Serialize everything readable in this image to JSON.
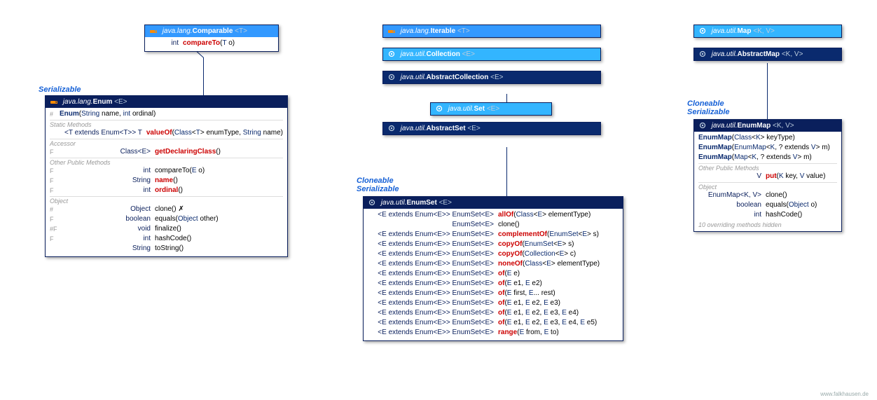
{
  "footer": "www.falkhausen.de",
  "tags": {
    "serializable": "Serializable",
    "cloneable_ser": "Cloneable\nSerializable",
    "cloneable_ser2": "Cloneable\nSerializable"
  },
  "comparable": {
    "pkg": "java.lang.",
    "name": "Comparable",
    "gen": "<T>",
    "rows": [
      {
        "mod": "",
        "ret": "int",
        "nm": "compareTo",
        "nmc": "red",
        "sig": "(T o)"
      }
    ]
  },
  "enum": {
    "pkg": "java.lang.",
    "name": "Enum",
    "gen": "<E>",
    "ctor": {
      "mod": "#",
      "name": "Enum",
      "sig": "(String name, int ordinal)"
    },
    "static_lbl": "Static Methods",
    "static": [
      {
        "mod": "",
        "ret": "<T extends Enum<T>> T",
        "nm": "valueOf",
        "nmc": "red",
        "sig": "(Class<T> enumType, String name)"
      }
    ],
    "accessor_lbl": "Accessor",
    "accessor": [
      {
        "mod": "F",
        "ret": "Class<E>",
        "nm": "getDeclaringClass",
        "nmc": "red",
        "sig": "()"
      }
    ],
    "other_lbl": "Other Public Methods",
    "other": [
      {
        "mod": "F",
        "ret": "int",
        "nm": "compareTo",
        "nmc": "",
        "sig": "(E o)"
      },
      {
        "mod": "F",
        "ret": "String",
        "nm": "name",
        "nmc": "red",
        "sig": "()"
      },
      {
        "mod": "F",
        "ret": "int",
        "nm": "ordinal",
        "nmc": "red",
        "sig": "()"
      }
    ],
    "object_lbl": "Object",
    "object": [
      {
        "mod": "#",
        "ret": "Object",
        "nm": "clone",
        "nmc": "",
        "sig": "() ✗",
        "note": ""
      },
      {
        "mod": "F",
        "ret": "boolean",
        "nm": "equals",
        "nmc": "",
        "sig": "(Object other)"
      },
      {
        "mod": "#F",
        "ret": "void",
        "nm": "finalize",
        "nmc": "",
        "sig": "()"
      },
      {
        "mod": "F",
        "ret": "int",
        "nm": "hashCode",
        "nmc": "",
        "sig": "()"
      },
      {
        "mod": "",
        "ret": "String",
        "nm": "toString",
        "nmc": "",
        "sig": "()"
      }
    ]
  },
  "stack": {
    "iterable": {
      "pkg": "java.lang.",
      "name": "Iterable",
      "gen": "<T>"
    },
    "collection": {
      "pkg": "java.util.",
      "name": "Collection",
      "gen": "<E>"
    },
    "abscoll": {
      "pkg": "java.util.",
      "name": "AbstractCollection",
      "gen": "<E>"
    },
    "set": {
      "pkg": "java.util.",
      "name": "Set",
      "gen": "<E>"
    },
    "absset": {
      "pkg": "java.util.",
      "name": "AbstractSet",
      "gen": "<E>"
    }
  },
  "enumset": {
    "pkg": "java.util.",
    "name": "EnumSet",
    "gen": "<E>",
    "rows": [
      {
        "pre": "<E extends Enum<E>>",
        "ret": "EnumSet<E>",
        "nm": "allOf",
        "nmc": "red",
        "sig": "(Class<E> elementType)"
      },
      {
        "pre": "",
        "ret": "EnumSet<E>",
        "nm": "clone",
        "nmc": "",
        "sig": "()"
      },
      {
        "pre": "<E extends Enum<E>>",
        "ret": "EnumSet<E>",
        "nm": "complementOf",
        "nmc": "red",
        "sig": "(EnumSet<E> s)"
      },
      {
        "pre": "<E extends Enum<E>>",
        "ret": "EnumSet<E>",
        "nm": "copyOf",
        "nmc": "red",
        "sig": "(EnumSet<E> s)"
      },
      {
        "pre": "<E extends Enum<E>>",
        "ret": "EnumSet<E>",
        "nm": "copyOf",
        "nmc": "red",
        "sig": "(Collection<E> c)"
      },
      {
        "pre": "<E extends Enum<E>>",
        "ret": "EnumSet<E>",
        "nm": "noneOf",
        "nmc": "red",
        "sig": "(Class<E> elementType)"
      },
      {
        "pre": "<E extends Enum<E>>",
        "ret": "EnumSet<E>",
        "nm": "of",
        "nmc": "red",
        "sig": "(E e)"
      },
      {
        "pre": "<E extends Enum<E>>",
        "ret": "EnumSet<E>",
        "nm": "of",
        "nmc": "red",
        "sig": "(E e1, E e2)"
      },
      {
        "pre": "<E extends Enum<E>>",
        "ret": "EnumSet<E>",
        "nm": "of",
        "nmc": "red",
        "sig": "(E first, E... rest)"
      },
      {
        "pre": "<E extends Enum<E>>",
        "ret": "EnumSet<E>",
        "nm": "of",
        "nmc": "red",
        "sig": "(E e1, E e2, E e3)"
      },
      {
        "pre": "<E extends Enum<E>>",
        "ret": "EnumSet<E>",
        "nm": "of",
        "nmc": "red",
        "sig": "(E e1, E e2, E e3, E e4)"
      },
      {
        "pre": "<E extends Enum<E>>",
        "ret": "EnumSet<E>",
        "nm": "of",
        "nmc": "red",
        "sig": "(E e1, E e2, E e3, E e4, E e5)"
      },
      {
        "pre": "<E extends Enum<E>>",
        "ret": "EnumSet<E>",
        "nm": "range",
        "nmc": "red",
        "sig": "(E from, E to)"
      }
    ]
  },
  "map": {
    "pkg": "java.util.",
    "name": "Map",
    "gen": "<K, V>"
  },
  "absmap": {
    "pkg": "java.util.",
    "name": "AbstractMap",
    "gen": "<K, V>"
  },
  "enummap": {
    "pkg": "java.util.",
    "name": "EnumMap",
    "gen": "<K, V>",
    "ctors": [
      {
        "name": "EnumMap",
        "sig": "(Class<K> keyType)"
      },
      {
        "name": "EnumMap",
        "sig": "(EnumMap<K, ? extends V> m)"
      },
      {
        "name": "EnumMap",
        "sig": "(Map<K, ? extends V> m)"
      }
    ],
    "other_lbl": "Other Public Methods",
    "other": [
      {
        "ret": "V",
        "nm": "put",
        "nmc": "red",
        "sig": "(K key, V value)"
      }
    ],
    "object_lbl": "Object",
    "object": [
      {
        "ret": "EnumMap<K, V>",
        "nm": "clone",
        "sig": "()"
      },
      {
        "ret": "boolean",
        "nm": "equals",
        "sig": "(Object o)"
      },
      {
        "ret": "int",
        "nm": "hashCode",
        "sig": "()"
      }
    ],
    "hidden": "10 overriding methods hidden"
  }
}
